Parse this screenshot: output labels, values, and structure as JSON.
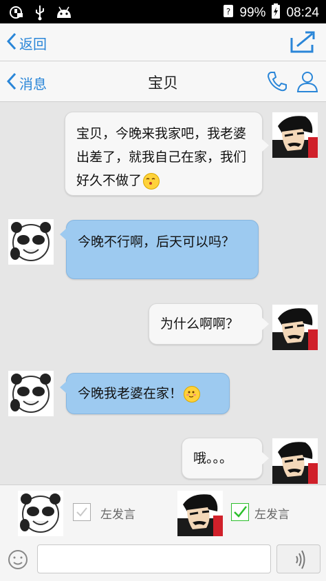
{
  "status_bar": {
    "battery": "99%",
    "time": "08:24",
    "icons": [
      "usb-debug-icon",
      "usb-icon",
      "android-icon",
      "signal-icon",
      "battery-charging-icon"
    ]
  },
  "top_bar": {
    "back_label": "返回",
    "icons": [
      "chevron-left-icon",
      "share-icon"
    ]
  },
  "chat_header": {
    "back_label": "消息",
    "title": "宝贝",
    "icons": [
      "phone-icon",
      "contact-icon"
    ]
  },
  "messages": [
    {
      "side": "right",
      "text": "宝贝，今晚来我家吧，我老婆出差了，就我自己在家，我们好久不做了",
      "emoji": "kiss-emoji-icon"
    },
    {
      "side": "left",
      "text": "今晚不行啊，后天可以吗？"
    },
    {
      "side": "right",
      "text": "为什么啊啊？"
    },
    {
      "side": "left",
      "text": "今晚我老婆在家！",
      "emoji": "blush-emoji-icon"
    },
    {
      "side": "right",
      "text": "哦。。。"
    }
  ],
  "speaker_panel": {
    "left_label": "左发言",
    "right_label": "左发言",
    "left_checked": false,
    "right_checked": true
  },
  "input": {
    "value": "",
    "placeholder": ""
  },
  "colors": {
    "accent": "#2a86d8",
    "left_bubble": "#9dcaf0",
    "right_bubble": "#f7f7f7",
    "check_green": "#2cbf2c"
  }
}
